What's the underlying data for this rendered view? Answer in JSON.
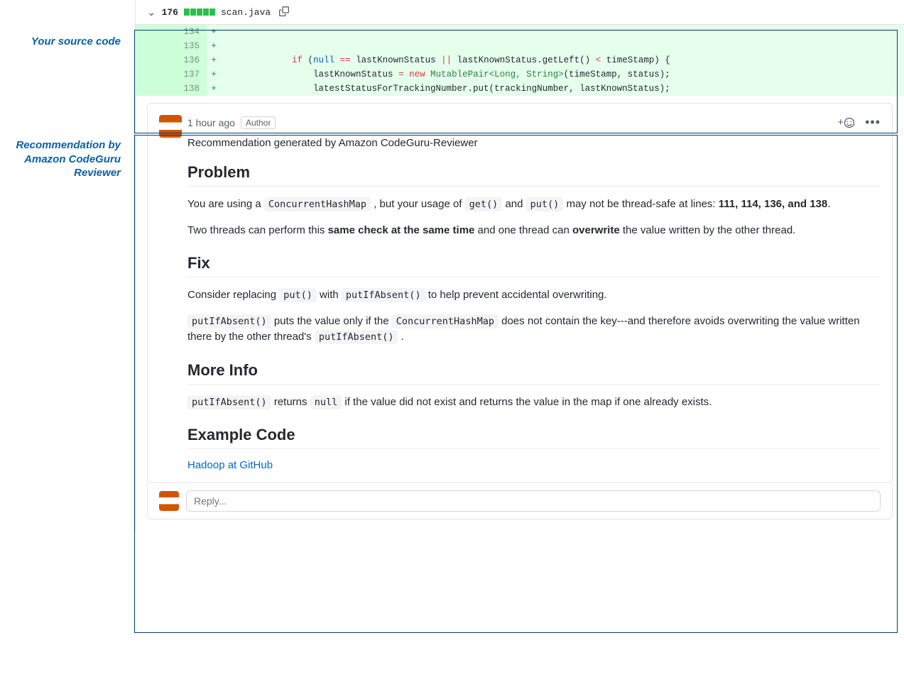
{
  "annotations": {
    "source_label": "Your source code",
    "recommendation_label": "Recommendation by Amazon CodeGuru Reviewer"
  },
  "file_header": {
    "line_count": "176",
    "filename": "scan.java"
  },
  "diff_lines": [
    {
      "num": "134",
      "plus": "+",
      "code": ""
    },
    {
      "num": "135",
      "plus": "+",
      "code": ""
    },
    {
      "num": "136",
      "plus": "+",
      "code_html": "            <span class='kw-if'>if</span> (<span class='kw-null'>null</span> <span class='op'>==</span> lastKnownStatus <span class='op'>||</span> lastKnownStatus.getLeft() <span class='op'>&lt;</span> timeStamp) {"
    },
    {
      "num": "137",
      "plus": "+",
      "code_html": "                lastKnownStatus <span class='op'>=</span> <span class='kw-new'>new</span> <span class='cls'>MutablePair&lt;Long, String&gt;</span>(timeStamp, status);"
    },
    {
      "num": "138",
      "plus": "+",
      "code_html": "                latestStatusForTrackingNumber.put(trackingNumber, lastKnownStatus);"
    }
  ],
  "comment": {
    "timestamp": "1 hour ago",
    "author_badge": "Author",
    "subtitle": "Recommendation generated by Amazon CodeGuru-Reviewer",
    "sections": {
      "problem_h": "Problem",
      "problem_p1_a": "You are using a ",
      "problem_p1_code1": "ConcurrentHashMap",
      "problem_p1_b": " , but your usage of ",
      "problem_p1_code2": "get()",
      "problem_p1_c": " and ",
      "problem_p1_code3": "put()",
      "problem_p1_d": " may not be thread-safe at lines: ",
      "problem_p1_bold": "111, 114, 136, and 138",
      "problem_p1_e": ".",
      "problem_p2_a": "Two threads can perform this ",
      "problem_p2_bold1": "same check at the same time",
      "problem_p2_b": " and one thread can ",
      "problem_p2_bold2": "overwrite",
      "problem_p2_c": " the value written by the other thread.",
      "fix_h": "Fix",
      "fix_p1_a": "Consider replacing ",
      "fix_p1_code1": "put()",
      "fix_p1_b": " with ",
      "fix_p1_code2": "putIfAbsent()",
      "fix_p1_c": " to help prevent accidental overwriting.",
      "fix_p2_code1": "putIfAbsent()",
      "fix_p2_a": " puts the value only if the ",
      "fix_p2_code2": "ConcurrentHashMap",
      "fix_p2_b": " does not contain the key---and therefore avoids overwriting the value written there by the other thread's ",
      "fix_p2_code3": "putIfAbsent()",
      "fix_p2_c": " .",
      "more_h": "More Info",
      "more_code1": "putIfAbsent()",
      "more_a": " returns ",
      "more_code2": "null",
      "more_b": " if the value did not exist and returns the value in the map if one already exists.",
      "example_h": "Example Code",
      "example_link": "Hadoop at GitHub"
    }
  },
  "reply": {
    "placeholder": "Reply..."
  }
}
